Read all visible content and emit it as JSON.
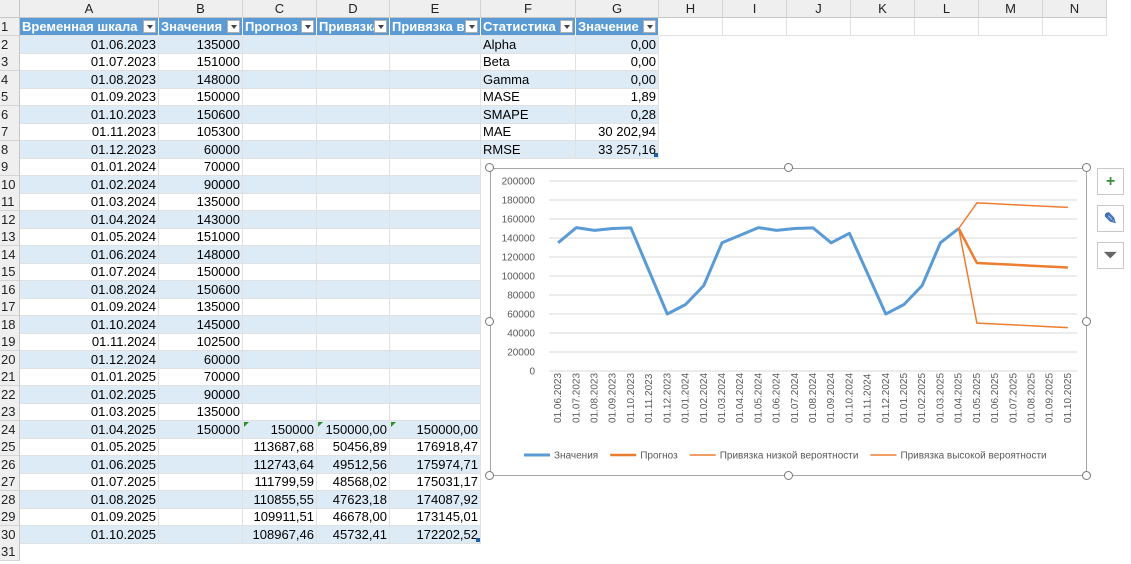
{
  "columns": [
    "A",
    "B",
    "C",
    "D",
    "E",
    "F",
    "G",
    "H",
    "I",
    "J",
    "K",
    "L",
    "M",
    "N"
  ],
  "header": {
    "A": "Временная шкала",
    "B": "Значения",
    "C": "Прогноз",
    "D": "Привязка",
    "E": "Привязка в",
    "F": "Статистика",
    "G": "Значение"
  },
  "rows": [
    {
      "date": "01.06.2023",
      "value": "135000"
    },
    {
      "date": "01.07.2023",
      "value": "151000"
    },
    {
      "date": "01.08.2023",
      "value": "148000"
    },
    {
      "date": "01.09.2023",
      "value": "150000"
    },
    {
      "date": "01.10.2023",
      "value": "150600"
    },
    {
      "date": "01.11.2023",
      "value": "105300"
    },
    {
      "date": "01.12.2023",
      "value": "60000"
    },
    {
      "date": "01.01.2024",
      "value": "70000"
    },
    {
      "date": "01.02.2024",
      "value": "90000"
    },
    {
      "date": "01.03.2024",
      "value": "135000"
    },
    {
      "date": "01.04.2024",
      "value": "143000"
    },
    {
      "date": "01.05.2024",
      "value": "151000"
    },
    {
      "date": "01.06.2024",
      "value": "148000"
    },
    {
      "date": "01.07.2024",
      "value": "150000"
    },
    {
      "date": "01.08.2024",
      "value": "150600"
    },
    {
      "date": "01.09.2024",
      "value": "135000"
    },
    {
      "date": "01.10.2024",
      "value": "145000"
    },
    {
      "date": "01.11.2024",
      "value": "102500"
    },
    {
      "date": "01.12.2024",
      "value": "60000"
    },
    {
      "date": "01.01.2025",
      "value": "70000"
    },
    {
      "date": "01.02.2025",
      "value": "90000"
    },
    {
      "date": "01.03.2025",
      "value": "135000"
    },
    {
      "date": "01.04.2025",
      "value": "150000",
      "forecast": "150000",
      "low": "150000,00",
      "high": "150000,00"
    },
    {
      "date": "01.05.2025",
      "forecast": "113687,68",
      "low": "50456,89",
      "high": "176918,47"
    },
    {
      "date": "01.06.2025",
      "forecast": "112743,64",
      "low": "49512,56",
      "high": "175974,71"
    },
    {
      "date": "01.07.2025",
      "forecast": "111799,59",
      "low": "48568,02",
      "high": "175031,17"
    },
    {
      "date": "01.08.2025",
      "forecast": "110855,55",
      "low": "47623,18",
      "high": "174087,92"
    },
    {
      "date": "01.09.2025",
      "forecast": "109911,51",
      "low": "46678,00",
      "high": "173145,01"
    },
    {
      "date": "01.10.2025",
      "forecast": "108967,46",
      "low": "45732,41",
      "high": "172202,52"
    }
  ],
  "stats": [
    {
      "name": "Alpha",
      "value": "0,00"
    },
    {
      "name": "Beta",
      "value": "0,00"
    },
    {
      "name": "Gamma",
      "value": "0,00"
    },
    {
      "name": "MASE",
      "value": "1,89"
    },
    {
      "name": "SMAPE",
      "value": "0,28"
    },
    {
      "name": "MAE",
      "value": "30 202,94"
    },
    {
      "name": "RMSE",
      "value": "33 257,16"
    }
  ],
  "chart_data": {
    "type": "line",
    "x": [
      "01.06.2023",
      "01.07.2023",
      "01.08.2023",
      "01.09.2023",
      "01.10.2023",
      "01.11.2023",
      "01.12.2023",
      "01.01.2024",
      "01.02.2024",
      "01.03.2024",
      "01.04.2024",
      "01.05.2024",
      "01.06.2024",
      "01.07.2024",
      "01.08.2024",
      "01.09.2024",
      "01.10.2024",
      "01.11.2024",
      "01.12.2024",
      "01.01.2025",
      "01.02.2025",
      "01.03.2025",
      "01.04.2025",
      "01.05.2025",
      "01.06.2025",
      "01.07.2025",
      "01.08.2025",
      "01.09.2025",
      "01.10.2025"
    ],
    "ylim": [
      0,
      200000
    ],
    "yticks": [
      "0",
      "20000",
      "40000",
      "60000",
      "80000",
      "100000",
      "120000",
      "140000",
      "160000",
      "180000",
      "200000"
    ],
    "grid": true,
    "legend": "bottom",
    "series": [
      {
        "name": "Значения",
        "color": "#5b9bd5",
        "width": 3,
        "values": [
          135000,
          151000,
          148000,
          150000,
          150600,
          105300,
          60000,
          70000,
          90000,
          135000,
          143000,
          151000,
          148000,
          150000,
          150600,
          135000,
          145000,
          102500,
          60000,
          70000,
          90000,
          135000,
          150000,
          null,
          null,
          null,
          null,
          null,
          null
        ]
      },
      {
        "name": "Прогноз",
        "color": "#ed7d31",
        "width": 2.5,
        "values": [
          null,
          null,
          null,
          null,
          null,
          null,
          null,
          null,
          null,
          null,
          null,
          null,
          null,
          null,
          null,
          null,
          null,
          null,
          null,
          null,
          null,
          null,
          150000,
          113687.68,
          112743.64,
          111799.59,
          110855.55,
          109911.51,
          108967.46
        ]
      },
      {
        "name": "Привязка низкой вероятности",
        "color": "#ed7d31",
        "width": 1.5,
        "values": [
          null,
          null,
          null,
          null,
          null,
          null,
          null,
          null,
          null,
          null,
          null,
          null,
          null,
          null,
          null,
          null,
          null,
          null,
          null,
          null,
          null,
          null,
          150000,
          50456.89,
          49512.56,
          48568.02,
          47623.18,
          46678.0,
          45732.41
        ]
      },
      {
        "name": "Привязка высокой вероятности",
        "color": "#ed7d31",
        "width": 1.5,
        "values": [
          null,
          null,
          null,
          null,
          null,
          null,
          null,
          null,
          null,
          null,
          null,
          null,
          null,
          null,
          null,
          null,
          null,
          null,
          null,
          null,
          null,
          null,
          150000,
          176918.47,
          175974.71,
          175031.17,
          174087.92,
          173145.01,
          172202.52
        ]
      }
    ]
  },
  "side_buttons": [
    {
      "name": "chart-elements-button",
      "icon": "plus-icon",
      "glyph": "+"
    },
    {
      "name": "chart-styles-button",
      "icon": "brush-icon",
      "glyph": "✎"
    },
    {
      "name": "chart-filters-button",
      "icon": "funnel-icon",
      "glyph": "⏷"
    }
  ]
}
